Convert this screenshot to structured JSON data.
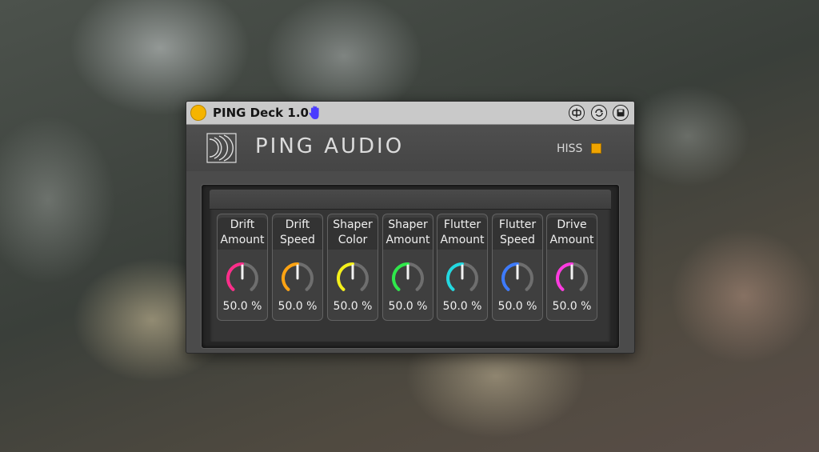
{
  "window": {
    "title": "PING Deck 1.0",
    "title_dot_color": "#f5b400",
    "hand_icon": "hand-icon",
    "buttons": [
      "freeze-icon",
      "hot-swap-icon",
      "save-icon"
    ]
  },
  "header": {
    "brand": "PING AUDIO",
    "logo_icon": "ping-logo-icon",
    "hiss_label": "HISS",
    "hiss_on": true,
    "hiss_color": "#f0a400"
  },
  "knobs": [
    {
      "label": "Drift\nAmount",
      "value": "50.0 %",
      "level": 0.5,
      "color": "#ff2d8a"
    },
    {
      "label": "Drift\nSpeed",
      "value": "50.0 %",
      "level": 0.5,
      "color": "#ffa312"
    },
    {
      "label": "Shaper\nColor",
      "value": "50.0 %",
      "level": 0.5,
      "color": "#f4f01a"
    },
    {
      "label": "Shaper\nAmount",
      "value": "50.0 %",
      "level": 0.5,
      "color": "#2ee84a"
    },
    {
      "label": "Flutter\nAmount",
      "value": "50.0 %",
      "level": 0.5,
      "color": "#22d8e0"
    },
    {
      "label": "Flutter\nSpeed",
      "value": "50.0 %",
      "level": 0.5,
      "color": "#3d7bff"
    },
    {
      "label": "Drive\nAmount",
      "value": "50.0 %",
      "level": 0.5,
      "color": "#ff3ae0"
    }
  ]
}
